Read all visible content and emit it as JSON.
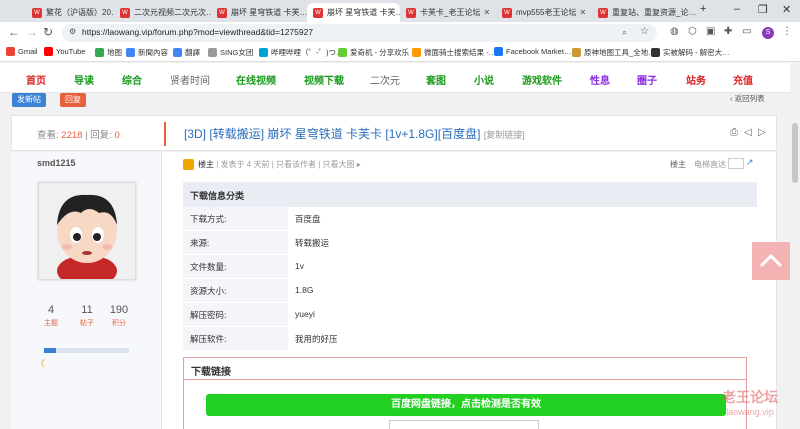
{
  "browser": {
    "tabs": [
      {
        "label": "繁花（沪语版）20…",
        "color": "#d33"
      },
      {
        "label": "二次元视频二次元次…",
        "color": "#d33"
      },
      {
        "label": "崩坏 星穹铁道 卡芙…",
        "color": "#d33"
      },
      {
        "label": "崩坏 星穹铁道 卡芙…",
        "color": "#d33"
      },
      {
        "label": "卡芙卡_老王论坛",
        "color": "#d33"
      },
      {
        "label": "mvp555老王论坛",
        "color": "#d33"
      },
      {
        "label": "重复站、重复资源_论…",
        "color": "#d33"
      }
    ],
    "url": "https://laowang.vip/forum.php?mod=viewthread&tid=1275927",
    "bookmarks": [
      {
        "label": "Gmail",
        "color": "#ea4335"
      },
      {
        "label": "YouTube",
        "color": "#ff0000"
      },
      {
        "label": "地图",
        "color": "#34a853"
      },
      {
        "label": "新聞內容",
        "color": "#4285f4"
      },
      {
        "label": "翻譯",
        "color": "#4285f4"
      },
      {
        "label": "SING女团",
        "color": "#999"
      },
      {
        "label": "哔哩哔哩（゜-゜)つ…",
        "color": "#00a1d6"
      },
      {
        "label": "爱奇机 - 分享欢乐",
        "color": "#6c3"
      },
      {
        "label": "微面骑士搜索结果 -…",
        "color": "#f90"
      },
      {
        "label": "Facebook Market…",
        "color": "#1877f2"
      },
      {
        "label": "原神地图工具_全地…",
        "color": "#c93"
      },
      {
        "label": "实被解码 - 解密大…",
        "color": "#333"
      }
    ]
  },
  "sitenav": {
    "items": [
      {
        "label": "首页",
        "color": "#d22"
      },
      {
        "label": "导读",
        "color": "#1a9a1a"
      },
      {
        "label": "综合",
        "color": "#1a9a1a"
      },
      {
        "label": "贤者时间",
        "color": "#666"
      },
      {
        "label": "在线视频",
        "color": "#1a9a1a"
      },
      {
        "label": "视频下载",
        "color": "#1a9a1a"
      },
      {
        "label": "二次元",
        "color": "#666"
      },
      {
        "label": "套图",
        "color": "#1a9a1a"
      },
      {
        "label": "小说",
        "color": "#1a9a1a"
      },
      {
        "label": "游戏软件",
        "color": "#1a9a1a"
      },
      {
        "label": "性息",
        "color": "#8a2be2"
      },
      {
        "label": "圈子",
        "color": "#8a2be2"
      },
      {
        "label": "站务",
        "color": "#d22"
      },
      {
        "label": "充值",
        "color": "#d22"
      }
    ]
  },
  "actions": {
    "new_post": "发新帖",
    "reply": "回复",
    "back_to_list": "返回列表"
  },
  "thread": {
    "views_label": "查看:",
    "views": "2218",
    "replies_label": "回复:",
    "replies": "0",
    "tag": "[3D]",
    "title": "[转载搬运] 崩坏 星穹铁道 卡芙卡 [1v+1.8G][百度盘]",
    "copy_link": "[复制链接]"
  },
  "author": {
    "name": "smd1215",
    "stats": [
      {
        "value": "4",
        "label": "主题"
      },
      {
        "value": "11",
        "label": "帖子"
      },
      {
        "value": "190",
        "label": "积分"
      }
    ]
  },
  "post": {
    "role": "楼主",
    "time": "发表于 4 天前",
    "only_author": "只看该作者",
    "only_large": "只看大图",
    "floor": "楼主",
    "jump": "电梯直达"
  },
  "download_info": {
    "heading": "下载信息分类",
    "rows": [
      {
        "key": "下载方式:",
        "value": "百度盘"
      },
      {
        "key": "来源:",
        "value": "转载搬运"
      },
      {
        "key": "文件数量:",
        "value": "1v"
      },
      {
        "key": "资源大小:",
        "value": "1.8G"
      },
      {
        "key": "解压密码:",
        "value": "yueyi"
      },
      {
        "key": "解压软件:",
        "value": "我用的好压"
      }
    ]
  },
  "download_link": {
    "heading": "下载链接",
    "button": "百度网盘链接，点击检测是否有效"
  },
  "watermark": {
    "line1": "老王论坛",
    "line2": "laowang.vip"
  }
}
